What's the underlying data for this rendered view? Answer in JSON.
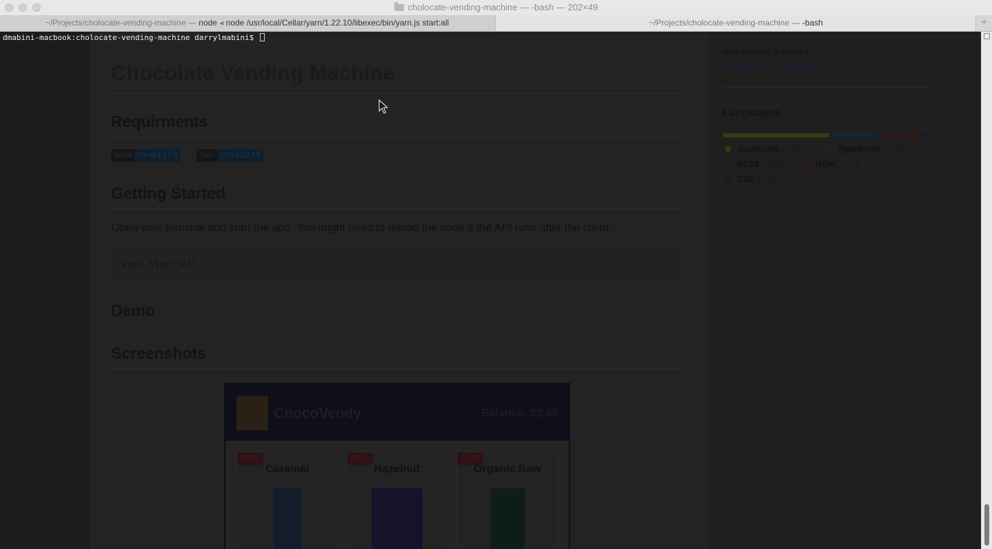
{
  "window": {
    "title": "cholocate-vending-machine — -bash — 202×49"
  },
  "tabs": [
    {
      "prefix": "~/Projects/cholocate-vending-machine — ",
      "process": "node",
      "sep": " ◂ ",
      "command": "node /usr/local/Cellar/yarn/1.22.10/libexec/bin/yarn.js start:all"
    },
    {
      "prefix": "~/Projects/cholocate-vending-machine — ",
      "process": "-bash"
    }
  ],
  "new_tab_label": "+",
  "terminal": {
    "prompt": "dmabini-macbook:cholocate-vending-machine darrylmabini$ "
  },
  "readme": {
    "title": "Chocolate Vending Machine",
    "requirements_heading": "Requirments",
    "badges": [
      {
        "key": "Node",
        "value": "=> v14.17.0"
      },
      {
        "key": "Yarn",
        "value": "=> v1.22.10"
      }
    ],
    "getting_started_heading": "Getting Started",
    "getting_started_text": "Open your terminal and start the app. You might need to reload the page if the API runs after the client.",
    "code": "yarn start:all",
    "demo_heading": "Demo",
    "screenshots_heading": "Screenshots",
    "app_screenshot": {
      "name": "ChocoVendy",
      "balance": "Balance: $2.80",
      "products": [
        {
          "price": "$2.50",
          "name": "Caramel"
        },
        {
          "price": "$3.10",
          "name": "Hazelnut"
        },
        {
          "price": "$2.00",
          "name": "Organic Raw"
        }
      ]
    }
  },
  "sidebar": {
    "packages_text": "No packages published",
    "packages_link": "Publish your first package",
    "languages_heading": "Languages",
    "languages": [
      {
        "name": "JavaScript",
        "percent": "53.9%",
        "share": 53.9,
        "color": "#3a3a10"
      },
      {
        "name": "TypeScript",
        "percent": "24.2%",
        "share": 24.2,
        "color": "#10282e"
      },
      {
        "name": "SCSS",
        "percent": "13.8%",
        "share": 13.8,
        "color": "#2e1620"
      },
      {
        "name": "HTML",
        "percent": "5.1%",
        "share": 5.1,
        "color": "#331612"
      },
      {
        "name": "CSS",
        "percent": "3.0%",
        "share": 3.0,
        "color": "#1a1530"
      }
    ]
  }
}
